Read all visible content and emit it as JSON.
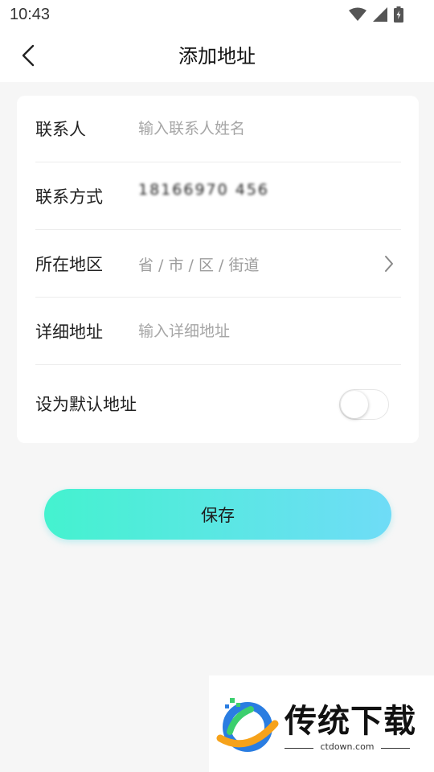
{
  "status_bar": {
    "time": "10:43"
  },
  "header": {
    "title": "添加地址"
  },
  "form": {
    "contact_label": "联系人",
    "contact_placeholder": "输入联系人姓名",
    "phone_label": "联系方式",
    "phone_value": "18166970 456",
    "region_label": "所在地区",
    "region_value": "省 / 市 / 区 / 街道",
    "address_label": "详细地址",
    "address_placeholder": "输入详细地址",
    "default_label": "设为默认地址",
    "default_on": false
  },
  "save_label": "保存",
  "watermark": {
    "text": "传统下载",
    "url": "ctdown.com"
  },
  "colors": {
    "accent_start": "#44f2cf",
    "accent_end": "#6fdcf7"
  }
}
